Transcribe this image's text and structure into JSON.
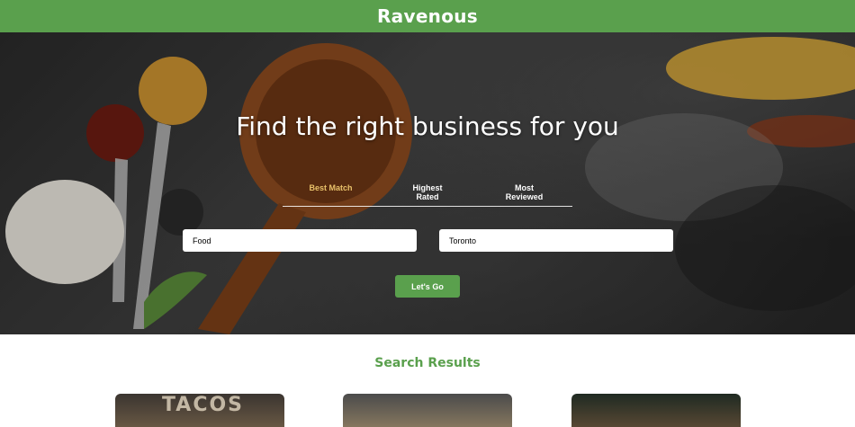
{
  "header": {
    "title": "Ravenous"
  },
  "hero": {
    "headline": "Find the right business for you",
    "sort_options": [
      {
        "label": "Best Match",
        "active": true
      },
      {
        "label": "Highest Rated",
        "active": false
      },
      {
        "label": "Most Reviewed",
        "active": false
      }
    ],
    "term_input": {
      "value": "Food"
    },
    "location_input": {
      "value": "Toronto"
    },
    "submit_label": "Let's Go"
  },
  "results": {
    "title": "Search Results",
    "cards": [
      {
        "image_text": "TACOS"
      },
      {
        "image_text": ""
      },
      {
        "image_text": ""
      }
    ]
  },
  "colors": {
    "brand_green": "#5aa04d",
    "active_tab": "#e8c16a"
  }
}
